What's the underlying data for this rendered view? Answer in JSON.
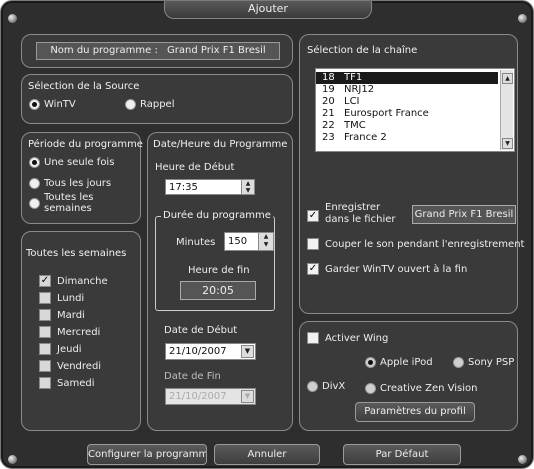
{
  "window": {
    "title": "Ajouter"
  },
  "program": {
    "name_label": "Nom du programme :",
    "name_value": "Grand Prix F1 Bresil"
  },
  "source": {
    "title": "Sélection de la Source",
    "options": [
      {
        "label": "WinTV",
        "selected": true
      },
      {
        "label": "Rappel",
        "selected": false
      }
    ]
  },
  "period": {
    "title": "Période du programme",
    "options": [
      {
        "label": "Une seule fois",
        "selected": true
      },
      {
        "label": "Tous les jours",
        "selected": false
      },
      {
        "label_line1": "Toutes les",
        "label_line2": "semaines",
        "selected": false
      }
    ]
  },
  "weekly": {
    "title": "Toutes les semaines",
    "days": [
      {
        "label": "Dimanche",
        "checked": true
      },
      {
        "label": "Lundi",
        "checked": false
      },
      {
        "label": "Mardi",
        "checked": false
      },
      {
        "label": "Mercredi",
        "checked": false
      },
      {
        "label": "Jeudi",
        "checked": false
      },
      {
        "label": "Vendredi",
        "checked": false
      },
      {
        "label": "Samedi",
        "checked": false
      }
    ]
  },
  "datetime": {
    "title": "Date/Heure du Programme",
    "start_time_label": "Heure de Début",
    "start_time_value": "17:35",
    "duration_title": "Durée du programme",
    "minutes_label": "Minutes",
    "minutes_value": "150",
    "end_time_label": "Heure de fin",
    "end_time_value": "20:05",
    "start_date_label": "Date de Début",
    "start_date_value": "21/10/2007",
    "end_date_label": "Date de Fin",
    "end_date_value": "21/10/2007"
  },
  "channels": {
    "title": "Sélection de la chaîne",
    "items": [
      {
        "num": "18",
        "name": "TF1",
        "selected": true
      },
      {
        "num": "19",
        "name": "NRJ12",
        "selected": false
      },
      {
        "num": "20",
        "name": "LCI",
        "selected": false
      },
      {
        "num": "21",
        "name": "Eurosport France",
        "selected": false
      },
      {
        "num": "22",
        "name": "TMC",
        "selected": false
      },
      {
        "num": "23",
        "name": "France 2",
        "selected": false
      }
    ]
  },
  "recording": {
    "save_line1": "Enregistrer",
    "save_line2": "dans le fichier",
    "save_checked": true,
    "file_name": "Grand Prix F1 Bresil",
    "mute_label": "Couper le son pendant l'enregistrement",
    "mute_checked": false,
    "keep_open_label": "Garder WinTV ouvert à la fin",
    "keep_open_checked": true
  },
  "wing": {
    "activate_label": "Activer Wing",
    "activate_checked": false,
    "devices": [
      {
        "label": "Apple iPod",
        "selected": true
      },
      {
        "label": "Sony PSP",
        "selected": false
      },
      {
        "label": "DivX",
        "selected": false
      },
      {
        "label": "Creative Zen Vision",
        "selected": false
      }
    ],
    "profile_button": "Paramètres du profil"
  },
  "footer": {
    "configure_button": "Configurer la programmation",
    "cancel_button": "Annuler",
    "default_button": "Par Défaut"
  }
}
